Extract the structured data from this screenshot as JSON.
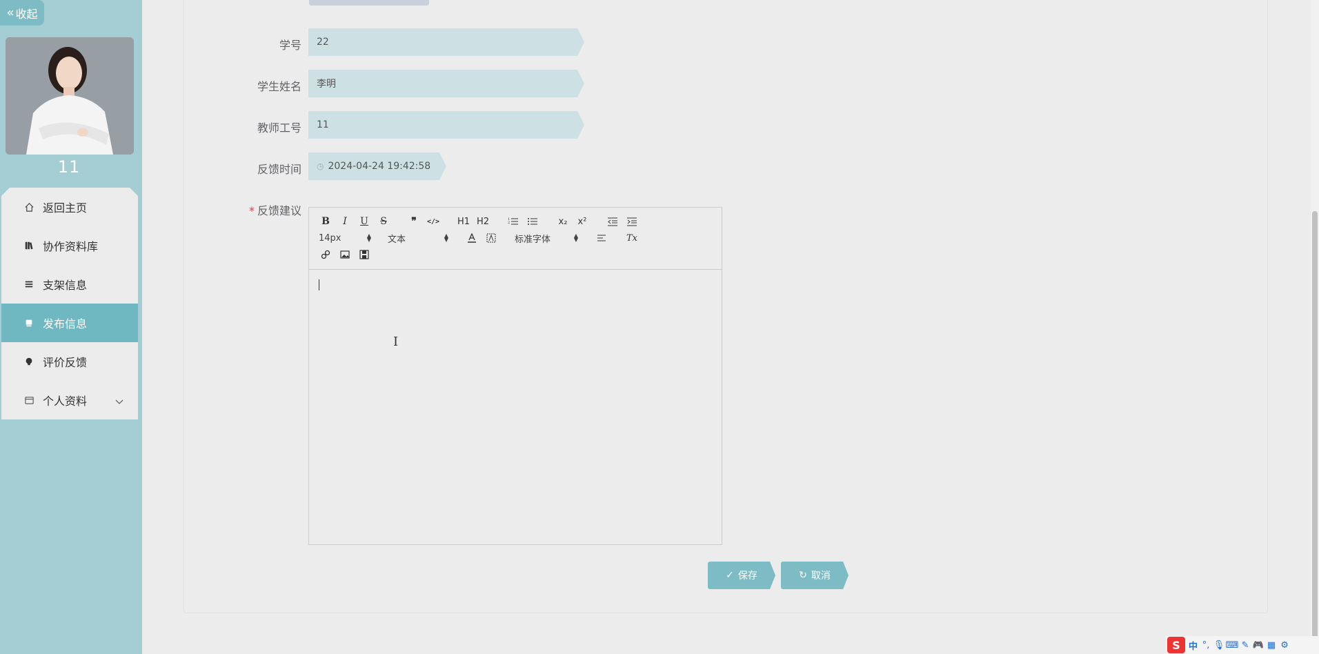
{
  "sidebar": {
    "collapse_label": "收起",
    "username": "11",
    "menu": [
      {
        "label": "返回主页",
        "icon": "home-icon"
      },
      {
        "label": "协作资料库",
        "icon": "library-icon"
      },
      {
        "label": "支架信息",
        "icon": "list-icon"
      },
      {
        "label": "发布信息",
        "icon": "publish-icon",
        "active": true
      },
      {
        "label": "评价反馈",
        "icon": "feedback-icon"
      },
      {
        "label": "个人资料",
        "icon": "profile-icon",
        "expandable": true
      }
    ]
  },
  "form": {
    "student_id": {
      "label": "学号",
      "value": "22"
    },
    "student_name": {
      "label": "学生姓名",
      "value": "李明"
    },
    "teacher_id": {
      "label": "教师工号",
      "value": "11"
    },
    "feedback_time": {
      "label": "反馈时间",
      "value": "2024-04-24 19:42:58"
    },
    "feedback_suggestion": {
      "label": "反馈建议",
      "required_mark": "*"
    }
  },
  "editor": {
    "font_size": "14px",
    "heading": "文本",
    "font_family": "标准字体",
    "toolbar": {
      "bold": "B",
      "italic": "I",
      "underline": "U",
      "strike": "S",
      "quote": "❞",
      "code": "</>",
      "h1": "H1",
      "h2": "H2",
      "subscript": "x₂",
      "superscript": "x²",
      "clean": "Tx"
    }
  },
  "buttons": {
    "save": "保存",
    "cancel": "取消"
  },
  "ime": {
    "zh": "中",
    "logo": "S"
  },
  "colors": {
    "sidebar_bg": "#a4ced3",
    "accent": "#7dbcc5",
    "active_item": "#6fb8c2",
    "field_bg": "#cde1e4"
  }
}
